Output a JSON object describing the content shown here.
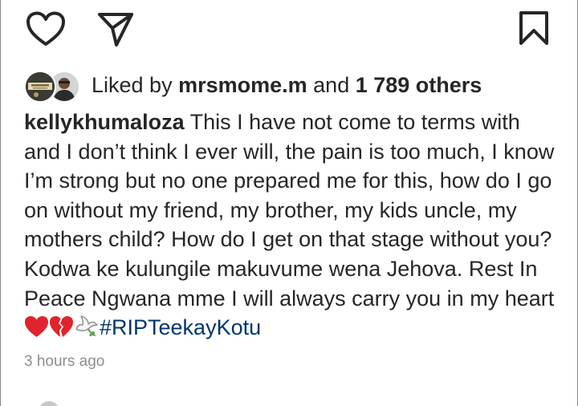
{
  "actions": {
    "like_icon": "heart-outline-icon",
    "share_icon": "paper-plane-icon",
    "save_icon": "bookmark-outline-icon"
  },
  "likes": {
    "prefix": "Liked by ",
    "user": "mrsmome.m",
    "connector": " and ",
    "others": "1 789 others"
  },
  "post": {
    "username": "kellykhumaloza",
    "caption": "This I have not come to terms with and I don’t think I ever will, the pain is too much, I know I’m strong but no one prepared me for this, how do I go on without my friend, my brother, my kids uncle, my mothers child? How do I get on that stage without you? Kodwa ke kulungile makuvume wena Jehova. Rest In Peace Ngwana mme I will always carry you in my heart",
    "emojis": [
      "red-heart",
      "broken-heart",
      "dove"
    ],
    "hashtag": "#RIPTeekayKotu",
    "timestamp": "3 hours ago"
  },
  "colors": {
    "text": "#262626",
    "muted": "#8e8e8e",
    "hashtag": "#00376b",
    "heart_red": "#e0242e"
  }
}
